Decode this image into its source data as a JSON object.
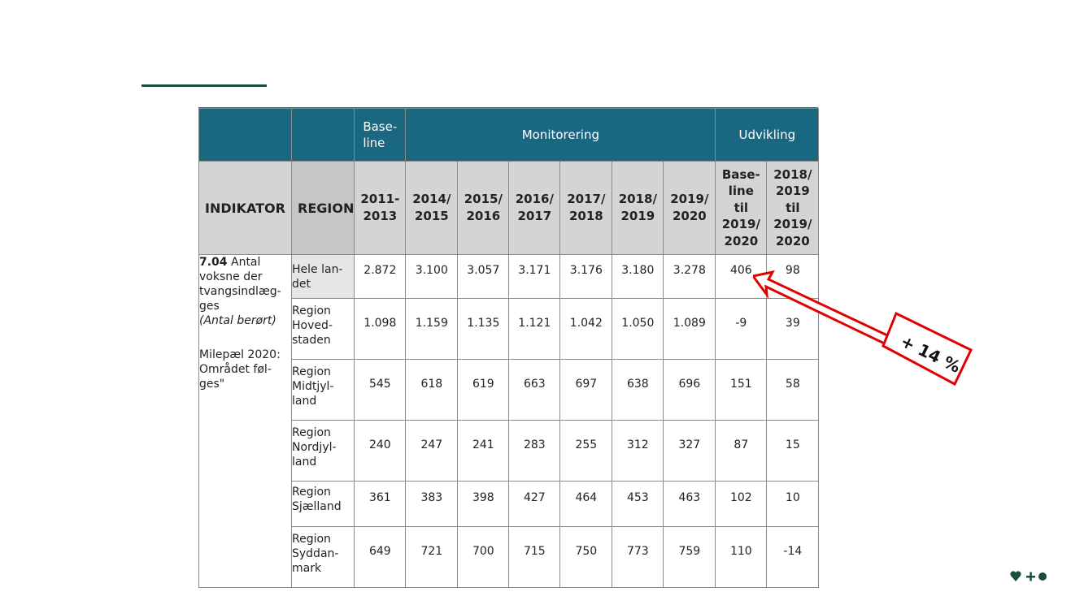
{
  "table": {
    "header_top": {
      "baseline": "Base-\nline",
      "monitoring": "Monitorering",
      "development": "Udvikling"
    },
    "header_cols": {
      "indicator": "INDIKATOR",
      "region": "REGION",
      "years": [
        "2011-\n2013",
        "2014/\n2015",
        "2015/\n2016",
        "2016/\n2017",
        "2017/\n2018",
        "2018/\n2019",
        "2019/\n2020"
      ],
      "dev": [
        "Base-\nline\ntil\n2019/\n2020",
        "2018/\n2019\ntil\n2019/\n2020"
      ]
    },
    "indicator": {
      "code": "7.04",
      "text": " Antal voksne der tvangsindlæg-ges",
      "subtitle": "(Antal berørt)",
      "milestone": "Milepæl 2020: Området føl-ges\""
    },
    "rows": [
      {
        "region": "Hele lan-\ndet",
        "values": [
          "2.872",
          "3.100",
          "3.057",
          "3.171",
          "3.176",
          "3.180",
          "3.278",
          "406",
          "98"
        ]
      },
      {
        "region": "Region\nHoved-\nstaden",
        "values": [
          "1.098",
          "1.159",
          "1.135",
          "1.121",
          "1.042",
          "1.050",
          "1.089",
          "-9",
          "39"
        ]
      },
      {
        "region": "Region\nMidtjyl-\nland",
        "values": [
          "545",
          "618",
          "619",
          "663",
          "697",
          "638",
          "696",
          "151",
          "58"
        ]
      },
      {
        "region": "Region\nNordjyl-\nland",
        "values": [
          "240",
          "247",
          "241",
          "283",
          "255",
          "312",
          "327",
          "87",
          "15"
        ]
      },
      {
        "region": "Region\nSjælland",
        "values": [
          "361",
          "383",
          "398",
          "427",
          "464",
          "453",
          "463",
          "102",
          "10"
        ]
      },
      {
        "region": "Region\nSyddan-\nmark",
        "values": [
          "649",
          "721",
          "700",
          "715",
          "750",
          "773",
          "759",
          "110",
          "-14"
        ]
      }
    ]
  },
  "annotation": {
    "label": "+ 14 %",
    "color": "#e00000"
  },
  "colors": {
    "header": "#1a6782",
    "subheader": "#d4d4d4",
    "brand": "#1a4c43"
  }
}
